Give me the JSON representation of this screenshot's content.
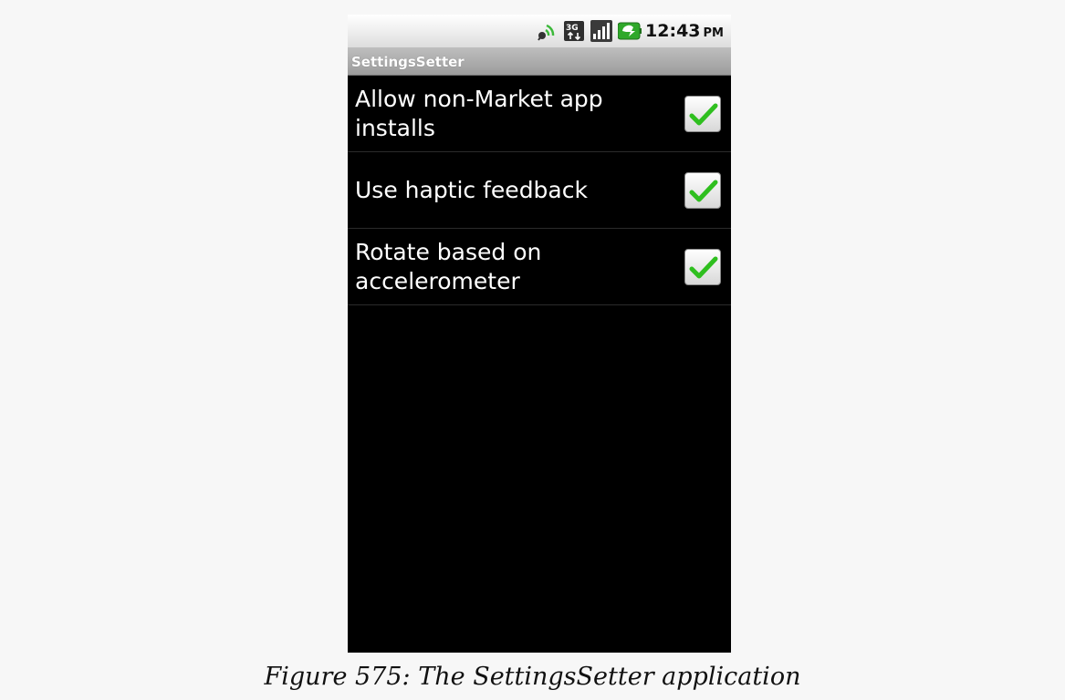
{
  "status_bar": {
    "time": "12:43",
    "ampm": "PM",
    "icons": [
      "gps-signal-icon",
      "3g-data-icon",
      "cell-signal-icon",
      "battery-charging-icon"
    ]
  },
  "app": {
    "title": "SettingsSetter"
  },
  "preferences": [
    {
      "label": "Allow non-Market app installs",
      "checked": true
    },
    {
      "label": "Use haptic feedback",
      "checked": true
    },
    {
      "label": "Rotate based on accelerometer",
      "checked": true
    }
  ],
  "caption": "Figure 575: The SettingsSetter application",
  "colors": {
    "check_green": "#2fbf1f",
    "screen_background": "#000000",
    "page_background": "#f7f7f7"
  }
}
